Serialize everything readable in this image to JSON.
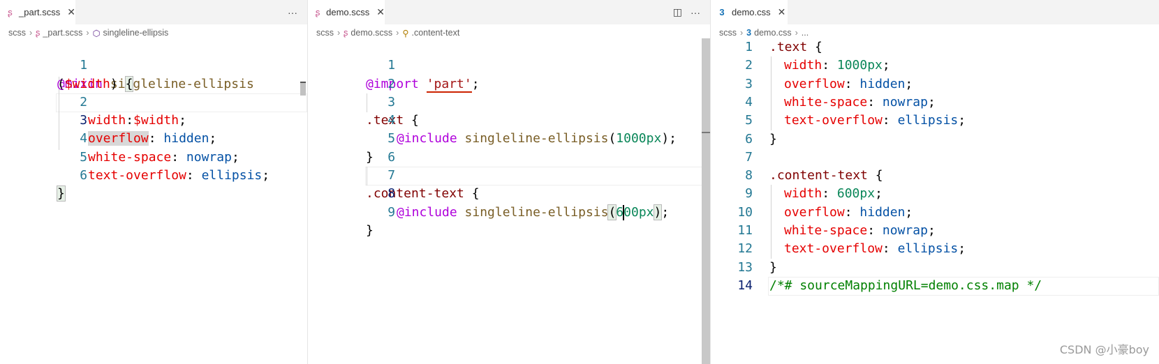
{
  "colors": {
    "accent_tab_icon": "#c6538c",
    "css_icon": "#1572b6"
  },
  "pane1": {
    "tab_label": "_part.scss",
    "tab_icon": "sass-icon",
    "close_icon": "✕",
    "more_icon": "···",
    "crumbs": [
      "scss",
      "_part.scss",
      "singleline-ellipsis"
    ],
    "lines": [
      {
        "n": "1"
      },
      {
        "n": ""
      },
      {
        "n": "2"
      },
      {
        "n": "3"
      },
      {
        "n": "4"
      },
      {
        "n": "5"
      },
      {
        "n": "6"
      }
    ],
    "code": {
      "l1": [
        "@mixin",
        " ",
        "singleline-ellipsis"
      ],
      "l1b": [
        "(",
        "$width",
        ") ",
        "{"
      ],
      "l2": [
        "width",
        ":",
        "$width",
        ";"
      ],
      "l3": [
        "overflow",
        ": ",
        "hidden",
        ";"
      ],
      "l4": [
        "white-space",
        ": ",
        "nowrap",
        ";"
      ],
      "l5": [
        "text-overflow",
        ": ",
        "ellipsis",
        ";"
      ],
      "l6": [
        "}"
      ]
    }
  },
  "pane2": {
    "tab_label": "demo.scss",
    "close_icon": "✕",
    "split_icon": "◫",
    "more_icon": "···",
    "crumbs": [
      "scss",
      "demo.scss",
      ".content-text"
    ],
    "lines": [
      "1",
      "2",
      "3",
      "4",
      "5",
      "6",
      "7",
      "8",
      "9"
    ],
    "code": {
      "l1": [
        "@import",
        " ",
        "'part'",
        ";"
      ],
      "l3": [
        ".text",
        " {"
      ],
      "l4": [
        "@include",
        " ",
        "singleline-ellipsis",
        "(",
        "1000px",
        ");"
      ],
      "l5": [
        "}"
      ],
      "l7": [
        ".content-text",
        " {"
      ],
      "l8": [
        "@include",
        " ",
        "singleline-ellipsis",
        "(",
        "6",
        "00px",
        ")",
        ";"
      ],
      "l9": [
        "}"
      ]
    }
  },
  "pane3": {
    "tab_label": "demo.css",
    "close_icon": "✕",
    "crumbs": [
      "scss",
      "demo.css",
      "..."
    ],
    "lines": [
      "1",
      "2",
      "3",
      "4",
      "5",
      "6",
      "7",
      "8",
      "9",
      "10",
      "11",
      "12",
      "13",
      "14"
    ],
    "code": {
      "l1": [
        ".text",
        " {"
      ],
      "l2": [
        "width",
        ": ",
        "1000px",
        ";"
      ],
      "l3": [
        "overflow",
        ": ",
        "hidden",
        ";"
      ],
      "l4": [
        "white-space",
        ": ",
        "nowrap",
        ";"
      ],
      "l5": [
        "text-overflow",
        ": ",
        "ellipsis",
        ";"
      ],
      "l6": [
        "}"
      ],
      "l8": [
        ".content-text",
        " {"
      ],
      "l9": [
        "width",
        ": ",
        "600px",
        ";"
      ],
      "l10": [
        "overflow",
        ": ",
        "hidden",
        ";"
      ],
      "l11": [
        "white-space",
        ": ",
        "nowrap",
        ";"
      ],
      "l12": [
        "text-overflow",
        ": ",
        "ellipsis",
        ";"
      ],
      "l13": [
        "}"
      ],
      "l14": [
        "/*# sourceMappingURL=demo.css.map */"
      ]
    }
  },
  "watermark": "CSDN @小豪boy"
}
